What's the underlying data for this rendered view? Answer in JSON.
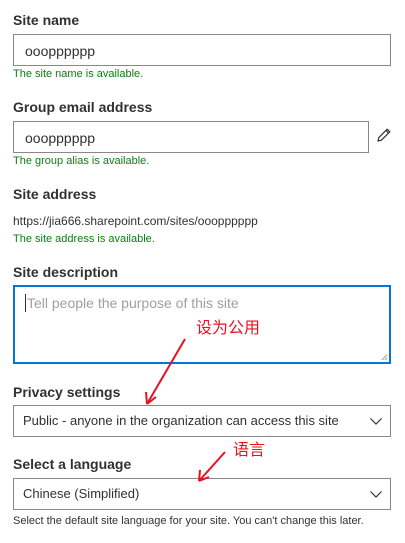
{
  "site_name": {
    "label": "Site name",
    "value": "ooopppppp",
    "status": "The site name is available."
  },
  "group_email": {
    "label": "Group email address",
    "value": "ooopppppp",
    "status": "The group alias is available.",
    "edit_icon": "pencil-icon"
  },
  "site_address": {
    "label": "Site address",
    "url": "https://jia666.sharepoint.com/sites/ooopppppp",
    "status": "The site address is available."
  },
  "site_description": {
    "label": "Site description",
    "placeholder": "Tell people the purpose of this site",
    "value": ""
  },
  "privacy": {
    "label": "Privacy settings",
    "selected": "Public - anyone in the organization can access this site"
  },
  "language": {
    "label": "Select a language",
    "selected": "Chinese (Simplified)",
    "note": "Select the default site language for your site. You can't change this later."
  },
  "annotations": {
    "privacy_note": "设为公用",
    "language_note": "语言",
    "color": "#e81123"
  },
  "colors": {
    "success": "#107c10",
    "focus": "#0078d4",
    "border": "#8a8886",
    "text": "#323130"
  }
}
